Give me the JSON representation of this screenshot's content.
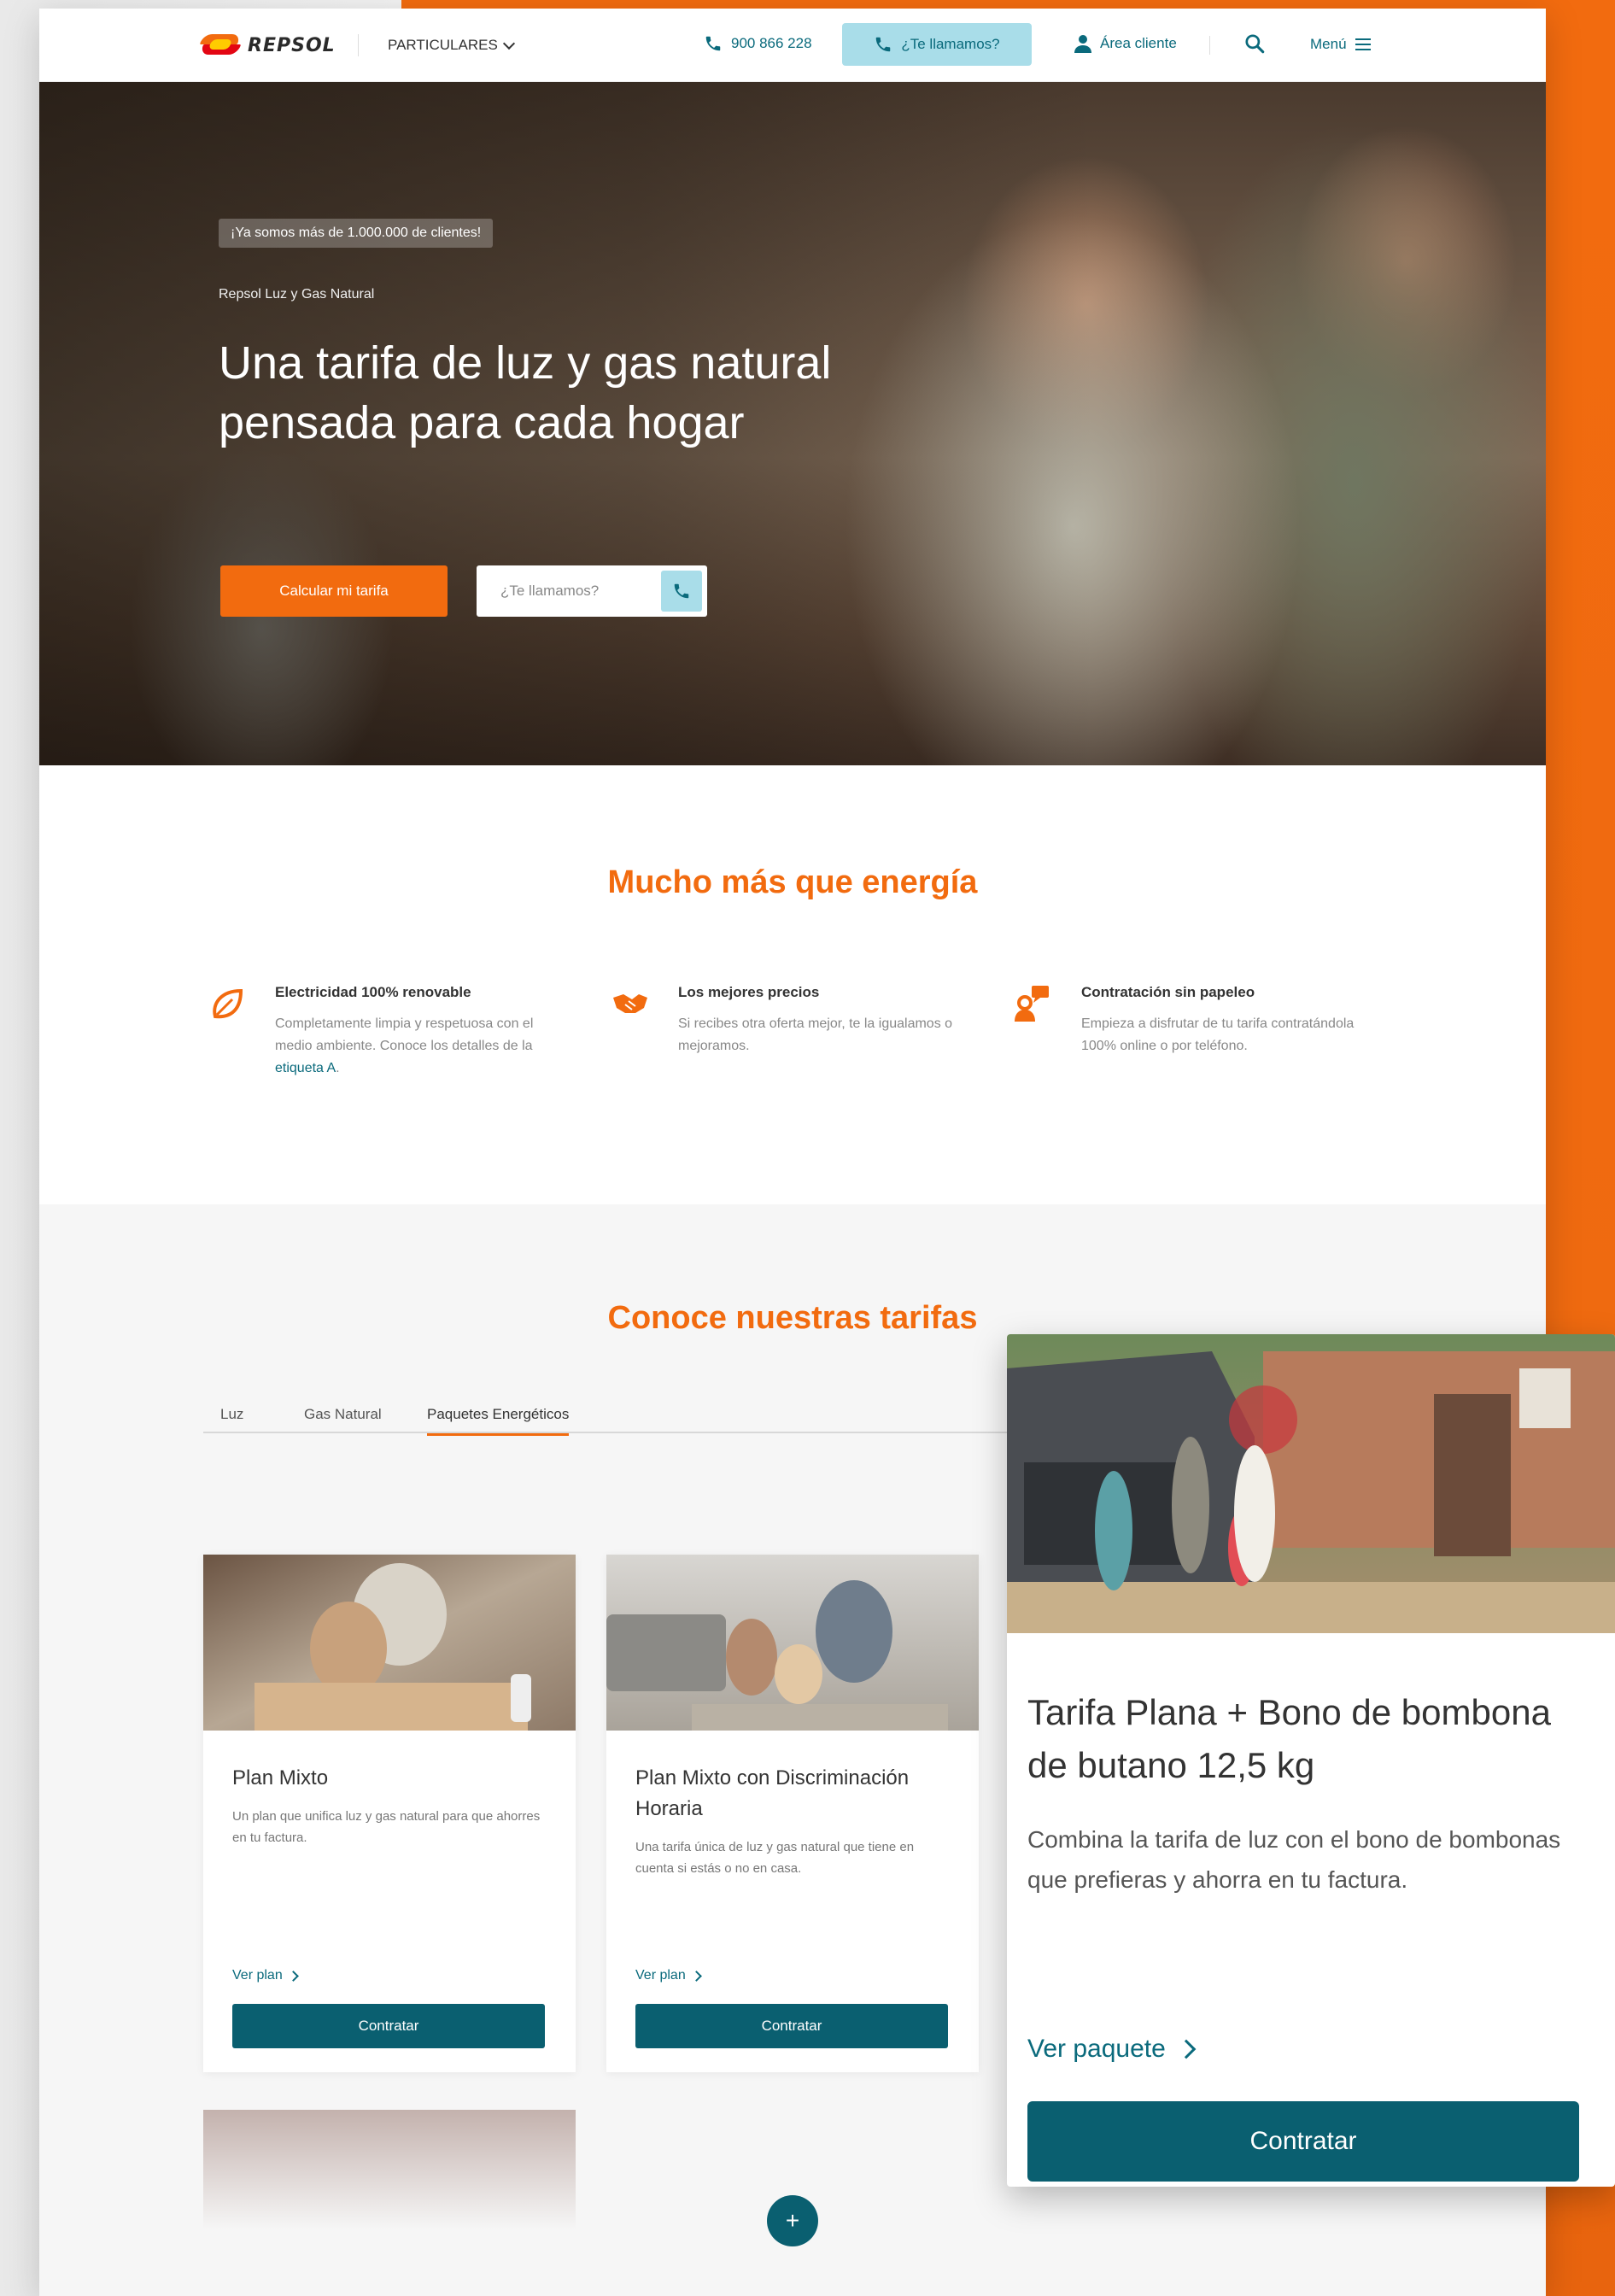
{
  "colors": {
    "brand_orange": "#f26b0f",
    "teal": "#0a5f70",
    "teal_text": "#0a6a7c",
    "call_bg": "#a9dde9"
  },
  "header": {
    "logo_text": "REPSOL",
    "segment": "PARTICULARES",
    "phone": "900 866 228",
    "call_button": "¿Te llamamos?",
    "area_cliente": "Área cliente",
    "menu": "Menú",
    "icons": [
      "repsol-logo",
      "chevron-down-icon",
      "phone-icon",
      "user-icon",
      "search-icon",
      "hamburger-icon"
    ]
  },
  "hero": {
    "counter_badge": "¡Ya somos más de 1.000.000 de clientes!",
    "eyebrow": "Repsol Luz y Gas Natural",
    "title": "Una tarifa de luz y gas natural pensada para cada hogar",
    "cta": "Calcular mi tarifa",
    "call_placeholder": "¿Te llamamos?"
  },
  "benefits": {
    "title": "Mucho más que energía",
    "items": [
      {
        "icon": "leaf-icon",
        "title": "Electricidad 100% renovable",
        "text": "Completamente limpia y respetuosa con el medio ambiente. Conoce los detalles de la",
        "link": "etiqueta A",
        "text_after": "."
      },
      {
        "icon": "handshake-icon",
        "title": "Los mejores precios",
        "text": "Si recibes otra oferta mejor, te la igualamos o mejoramos."
      },
      {
        "icon": "chat-person-icon",
        "title": "Contratación sin papeleo",
        "text": "Empieza a disfrutar de tu tarifa contratándola 100% online o por teléfono."
      }
    ]
  },
  "tarifas": {
    "title": "Conoce nuestras tarifas",
    "tabs": [
      {
        "label": "Luz",
        "active": false
      },
      {
        "label": "Gas Natural",
        "active": false
      },
      {
        "label": "Paquetes Energéticos",
        "active": true
      }
    ],
    "cards": [
      {
        "title": "Plan Mixto",
        "text": "Un plan que unifica luz y gas natural para que ahorres en tu factura.",
        "link": "Ver plan",
        "button": "Contratar"
      },
      {
        "title": "Plan Mixto con Discriminación Horaria",
        "text": "Una tarifa única de luz y gas natural que tiene en cuenta si estás o no en casa.",
        "link": "Ver plan",
        "button": "Contratar"
      }
    ],
    "more_button": "+"
  },
  "zoom_card": {
    "title": "Tarifa Plana + Bono de bombona de butano 12,5 kg",
    "text": "Combina la tarifa de luz con el bono de bombonas que prefieras y ahorra en tu factura.",
    "link": "Ver paquete",
    "button": "Contratar"
  }
}
